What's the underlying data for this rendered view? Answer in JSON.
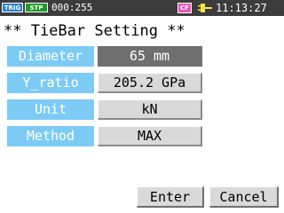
{
  "status_bar": {
    "trig_badge": "TRIG",
    "stp_badge": "STP",
    "counter": "000:255",
    "cf_badge": "CF",
    "plug_icon": "plug-icon",
    "clock": "11:13:27",
    "background_color": "#3c3c3c"
  },
  "page": {
    "title": "** TieBar Setting **"
  },
  "settings": [
    {
      "label": "Diameter",
      "value": "65 mm",
      "selected": true
    },
    {
      "label": "Y_ratio",
      "value": "205.2 GPa",
      "selected": false
    },
    {
      "label": "Unit",
      "value": "kN",
      "selected": false
    },
    {
      "label": "Method",
      "value": "MAX",
      "selected": false
    }
  ],
  "buttons": {
    "enter": "Enter",
    "cancel": "Cancel"
  },
  "colors": {
    "label_bg": "#7dcbf5",
    "value_bg": "#d9d9d9",
    "value_selected_bg": "#6f6f6f",
    "trig_badge": "#2d7fcf",
    "stp_badge": "#1e9a2a",
    "cf_badge": "#e05ab8"
  }
}
